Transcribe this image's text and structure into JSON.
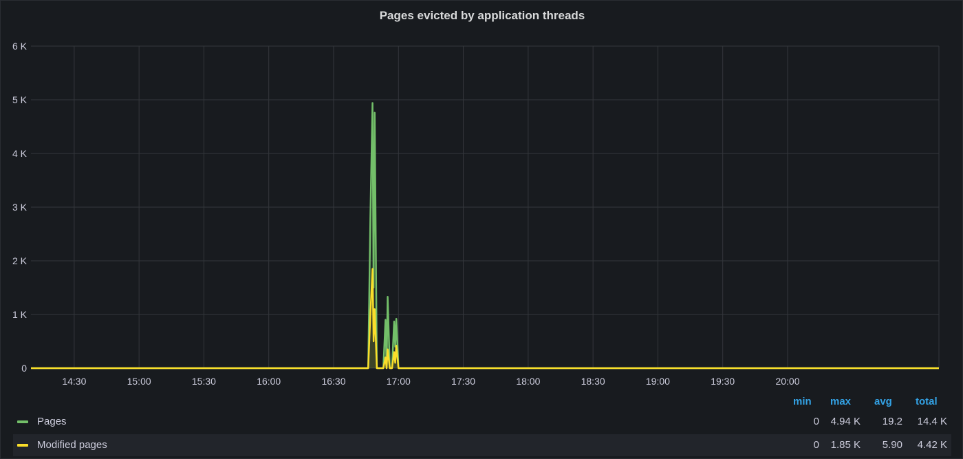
{
  "chart_data": {
    "type": "line",
    "title": "Pages evicted by application threads",
    "y_ticks": [
      "0",
      "1 K",
      "2 K",
      "3 K",
      "4 K",
      "5 K",
      "6 K"
    ],
    "ylim": [
      0,
      6000
    ],
    "x_ticks": [
      "14:30",
      "15:00",
      "15:30",
      "16:00",
      "16:30",
      "17:00",
      "17:30",
      "18:00",
      "18:30",
      "19:00",
      "19:30",
      "20:00"
    ],
    "xlim": [
      "14:10",
      "21:10"
    ],
    "grid": true,
    "legend_placement": "bottom",
    "series": [
      {
        "name": "Pages",
        "color": "#73bf69",
        "points": [
          [
            "14:10",
            0
          ],
          [
            "16:46",
            0
          ],
          [
            "16:47",
            2800
          ],
          [
            "16:48",
            4940
          ],
          [
            "16:48.5",
            1500
          ],
          [
            "16:49",
            4760
          ],
          [
            "16:50",
            0
          ],
          [
            "16:53",
            0
          ],
          [
            "16:54",
            900
          ],
          [
            "16:54.5",
            0
          ],
          [
            "16:55",
            1330
          ],
          [
            "16:56",
            0
          ],
          [
            "16:57",
            0
          ],
          [
            "16:58",
            870
          ],
          [
            "16:58.5",
            400
          ],
          [
            "16:59",
            920
          ],
          [
            "17:00",
            0
          ],
          [
            "21:10",
            0
          ]
        ]
      },
      {
        "name": "Modified pages",
        "color": "#fade2a",
        "points": [
          [
            "14:10",
            0
          ],
          [
            "16:46",
            0
          ],
          [
            "16:47",
            1000
          ],
          [
            "16:48",
            1850
          ],
          [
            "16:48.5",
            500
          ],
          [
            "16:49",
            1100
          ],
          [
            "16:50",
            0
          ],
          [
            "16:53",
            0
          ],
          [
            "16:54",
            200
          ],
          [
            "16:54.5",
            0
          ],
          [
            "16:55",
            350
          ],
          [
            "16:56",
            0
          ],
          [
            "16:57",
            0
          ],
          [
            "16:58",
            300
          ],
          [
            "16:58.5",
            100
          ],
          [
            "16:59",
            420
          ],
          [
            "17:00",
            0
          ],
          [
            "21:10",
            0
          ]
        ]
      }
    ]
  },
  "legend": {
    "headers": {
      "min": "min",
      "max": "max",
      "avg": "avg",
      "total": "total"
    },
    "rows": [
      {
        "name": "Pages",
        "color": "#73bf69",
        "min": "0",
        "max": "4.94 K",
        "avg": "19.2",
        "total": "14.4 K"
      },
      {
        "name": "Modified pages",
        "color": "#fade2a",
        "min": "0",
        "max": "1.85 K",
        "avg": "5.90",
        "total": "4.42 K"
      }
    ]
  }
}
